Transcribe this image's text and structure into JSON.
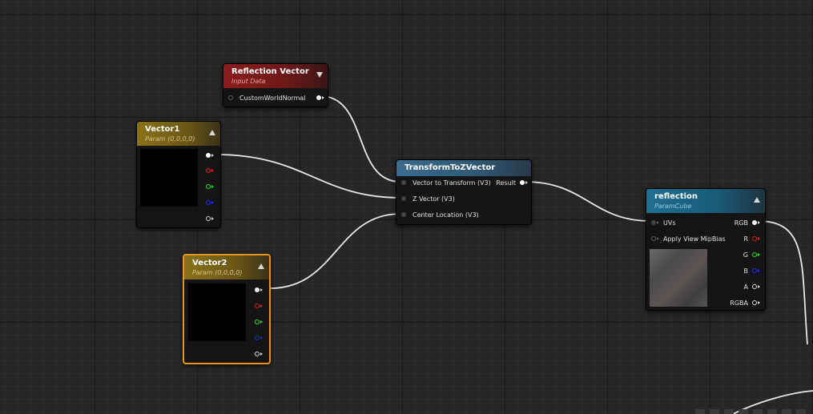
{
  "nodes": {
    "reflection_vector": {
      "title": "Reflection Vector",
      "subtitle": "Input Data",
      "output_pin": "CustomWorldNormal"
    },
    "vector1": {
      "title": "Vector1",
      "subtitle": "Param (0,0,0,0)"
    },
    "vector2": {
      "title": "Vector2",
      "subtitle": "Param (0,0,0,0)"
    },
    "transform": {
      "title": "TransformToZVector",
      "inputs": [
        "Vector to Transform (V3)",
        "Z Vector (V3)",
        "Center Location (V3)"
      ],
      "output": "Result"
    },
    "reflection": {
      "title": "reflection",
      "subtitle": "ParamCube",
      "inputs": [
        "UVs",
        "Apply View MipBias"
      ],
      "outputs": [
        "RGB",
        "R",
        "G",
        "B",
        "A",
        "RGBA"
      ]
    }
  },
  "colors": {
    "selected_outline": "#e6951e",
    "pin_red": "#e81c1c",
    "pin_green": "#1ee81c",
    "pin_blue": "#1c33ff",
    "wire": "#e8e8e8"
  }
}
